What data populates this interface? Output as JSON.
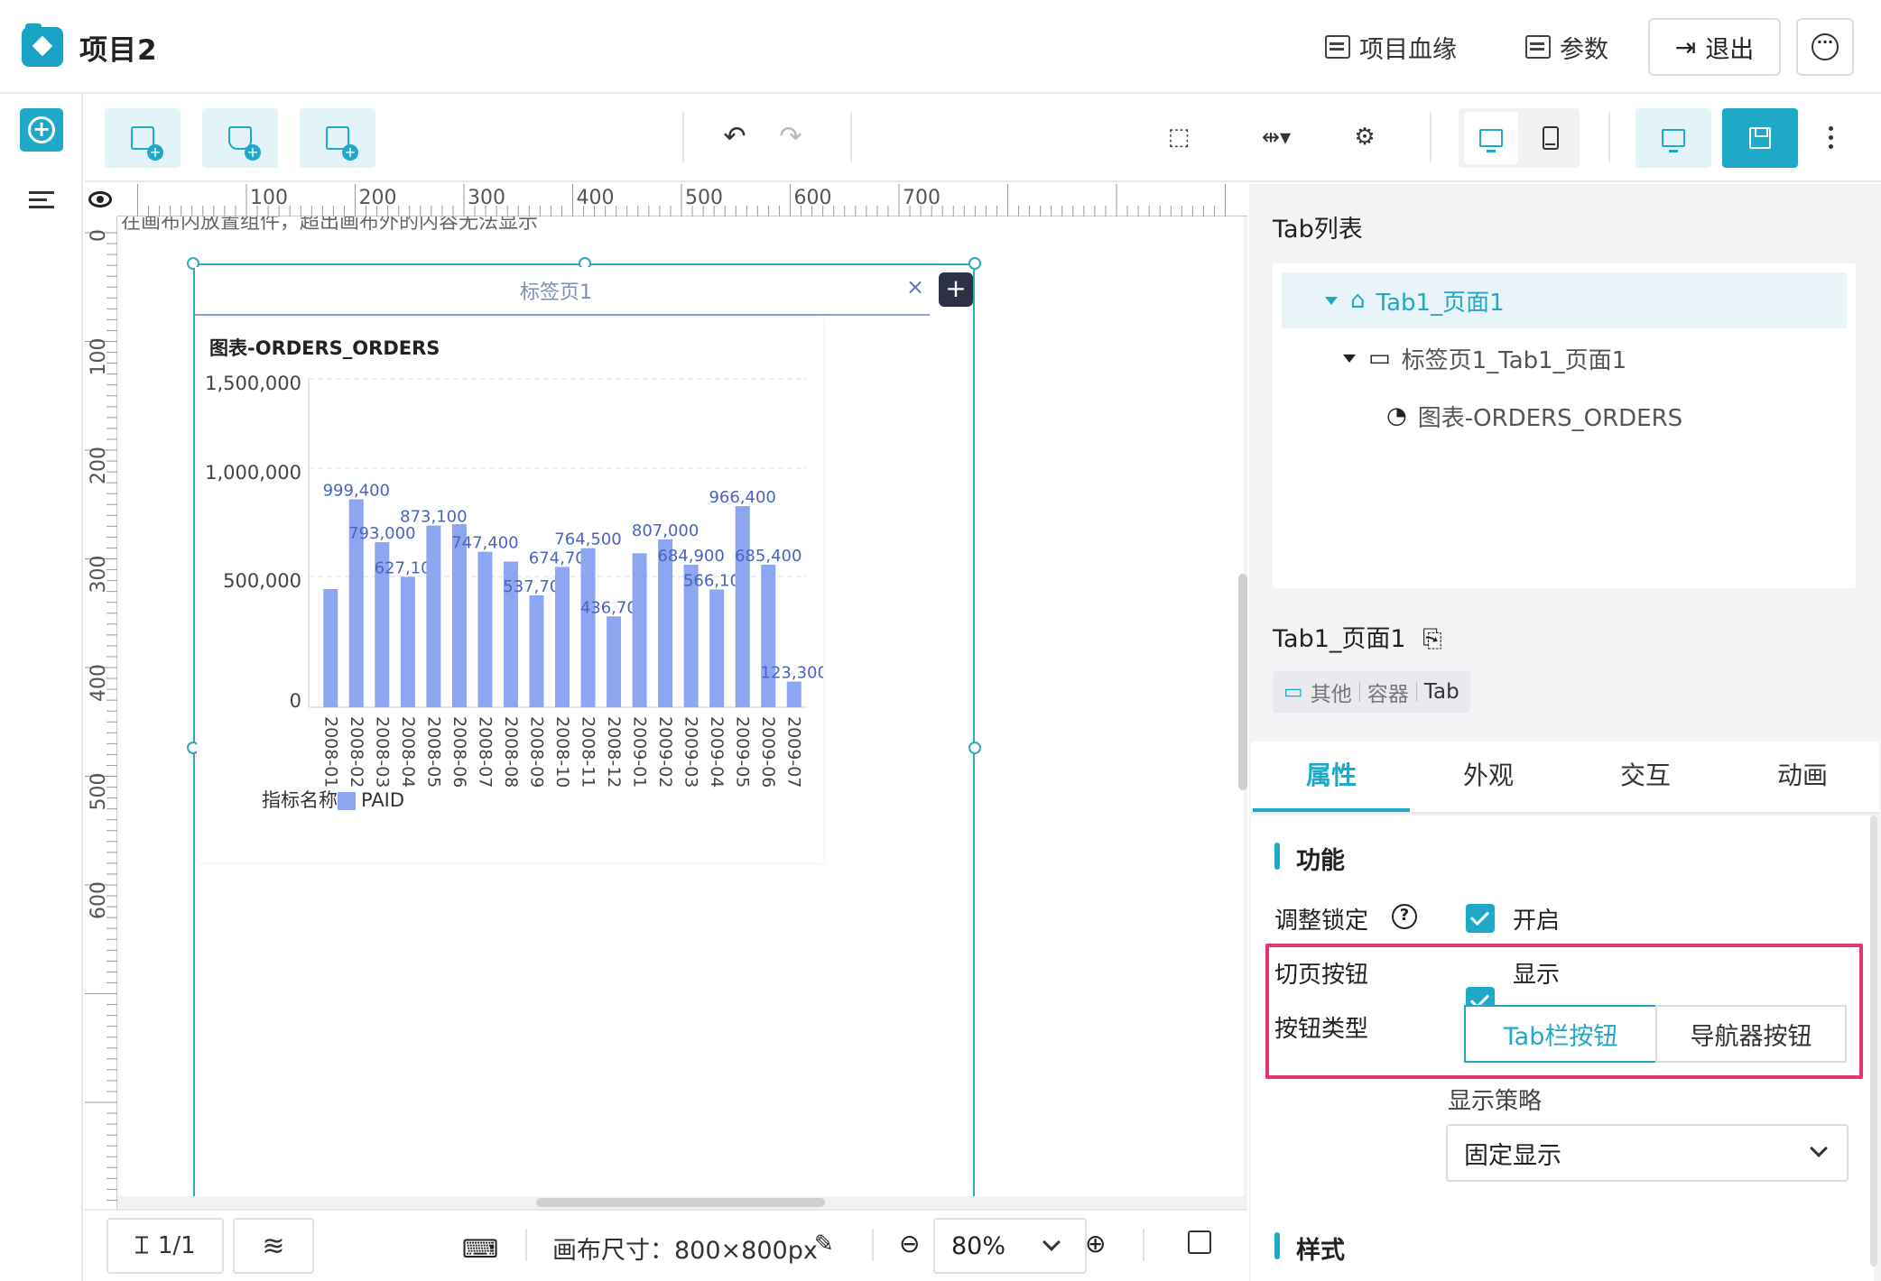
{
  "app": {
    "title": "项目2"
  },
  "header": {
    "lineage_label": "项目血缘",
    "params_label": "参数",
    "logout_label": "退出",
    "more_icon": "ellipsis-icon"
  },
  "canvas": {
    "hint": "在画布内放置组件，超出画布外的内容无法显示",
    "ruler_h": [
      "100",
      "200",
      "300",
      "400",
      "500",
      "600",
      "700"
    ],
    "ruler_v": [
      "0",
      "100",
      "200",
      "300",
      "400",
      "500",
      "600"
    ],
    "tab_label": "标签页1",
    "close_glyph": "×",
    "add_glyph": "+",
    "size_label": "画布尺寸：800×800px",
    "page_indicator": "1/1",
    "zoom": "80%"
  },
  "chart_data": {
    "type": "bar",
    "title": "图表-ORDERS_ORDERS",
    "categories": [
      "2008-01",
      "2008-02",
      "2008-03",
      "2008-04",
      "2008-05",
      "2008-06",
      "2008-07",
      "2008-08",
      "2008-09",
      "2008-10",
      "2008-11",
      "2008-12",
      "2009-01",
      "2009-02",
      "2009-03",
      "2009-04",
      "2009-05",
      "2009-06",
      "2009-07"
    ],
    "series": [
      {
        "name": "PAID",
        "values": [
          568000,
          999400,
          793000,
          627100,
          873100,
          880000,
          747400,
          700000,
          537700,
          674700,
          764500,
          436700,
          740000,
          807000,
          684900,
          566100,
          966400,
          685400,
          123300
        ]
      }
    ],
    "data_labels": [
      {
        "category": "2008-02",
        "text": "999,400"
      },
      {
        "category": "2008-03",
        "text": "793,000"
      },
      {
        "category": "2008-04",
        "text": "627,100"
      },
      {
        "category": "2008-05",
        "text": "873,100"
      },
      {
        "category": "2008-07",
        "text": "747,400"
      },
      {
        "category": "2008-09",
        "text": "537,700"
      },
      {
        "category": "2008-10",
        "text": "674,700"
      },
      {
        "category": "2008-11",
        "text": "764,500"
      },
      {
        "category": "2008-12",
        "text": "436,700"
      },
      {
        "category": "2009-02",
        "text": "807,000"
      },
      {
        "category": "2009-03",
        "text": "684,900"
      },
      {
        "category": "2009-04",
        "text": "566,100"
      },
      {
        "category": "2009-05",
        "text": "966,400"
      },
      {
        "category": "2009-06",
        "text": "685,400"
      },
      {
        "category": "2009-07",
        "text": "123,300"
      }
    ],
    "y_ticks": [
      "1,500,000",
      "1,000,000",
      "500,000",
      "0"
    ],
    "ylim": [
      0,
      1500000
    ],
    "legend_title": "指标名称",
    "legend_placement": "bottom",
    "bar_color": "#8ea6f2",
    "grid": true
  },
  "panel": {
    "tablist_title": "Tab列表",
    "tree": [
      {
        "label": "Tab1_页面1",
        "icon": "inbox-icon"
      },
      {
        "label": "标签页1_Tab1_页面1",
        "icon": "folder-icon"
      },
      {
        "label": "图表-ORDERS_ORDERS",
        "icon": "pie-chart-icon"
      }
    ],
    "selected_name": "Tab1_页面1",
    "tags": [
      "其他",
      "容器",
      "Tab"
    ],
    "tabs": [
      "属性",
      "外观",
      "交互",
      "动画"
    ],
    "section_function": "功能",
    "lock_label": "调整锁定",
    "lock_value": "开启",
    "page_btn_label": "切页按钮",
    "page_btn_value": "显示",
    "btn_type_label": "按钮类型",
    "btn_type_options": [
      "Tab栏按钮",
      "导航器按钮"
    ],
    "strategy_label": "显示策略",
    "strategy_value": "固定显示",
    "section_style": "样式"
  },
  "colors": {
    "accent": "#1fa9c9",
    "highlight": "#e5356f"
  }
}
